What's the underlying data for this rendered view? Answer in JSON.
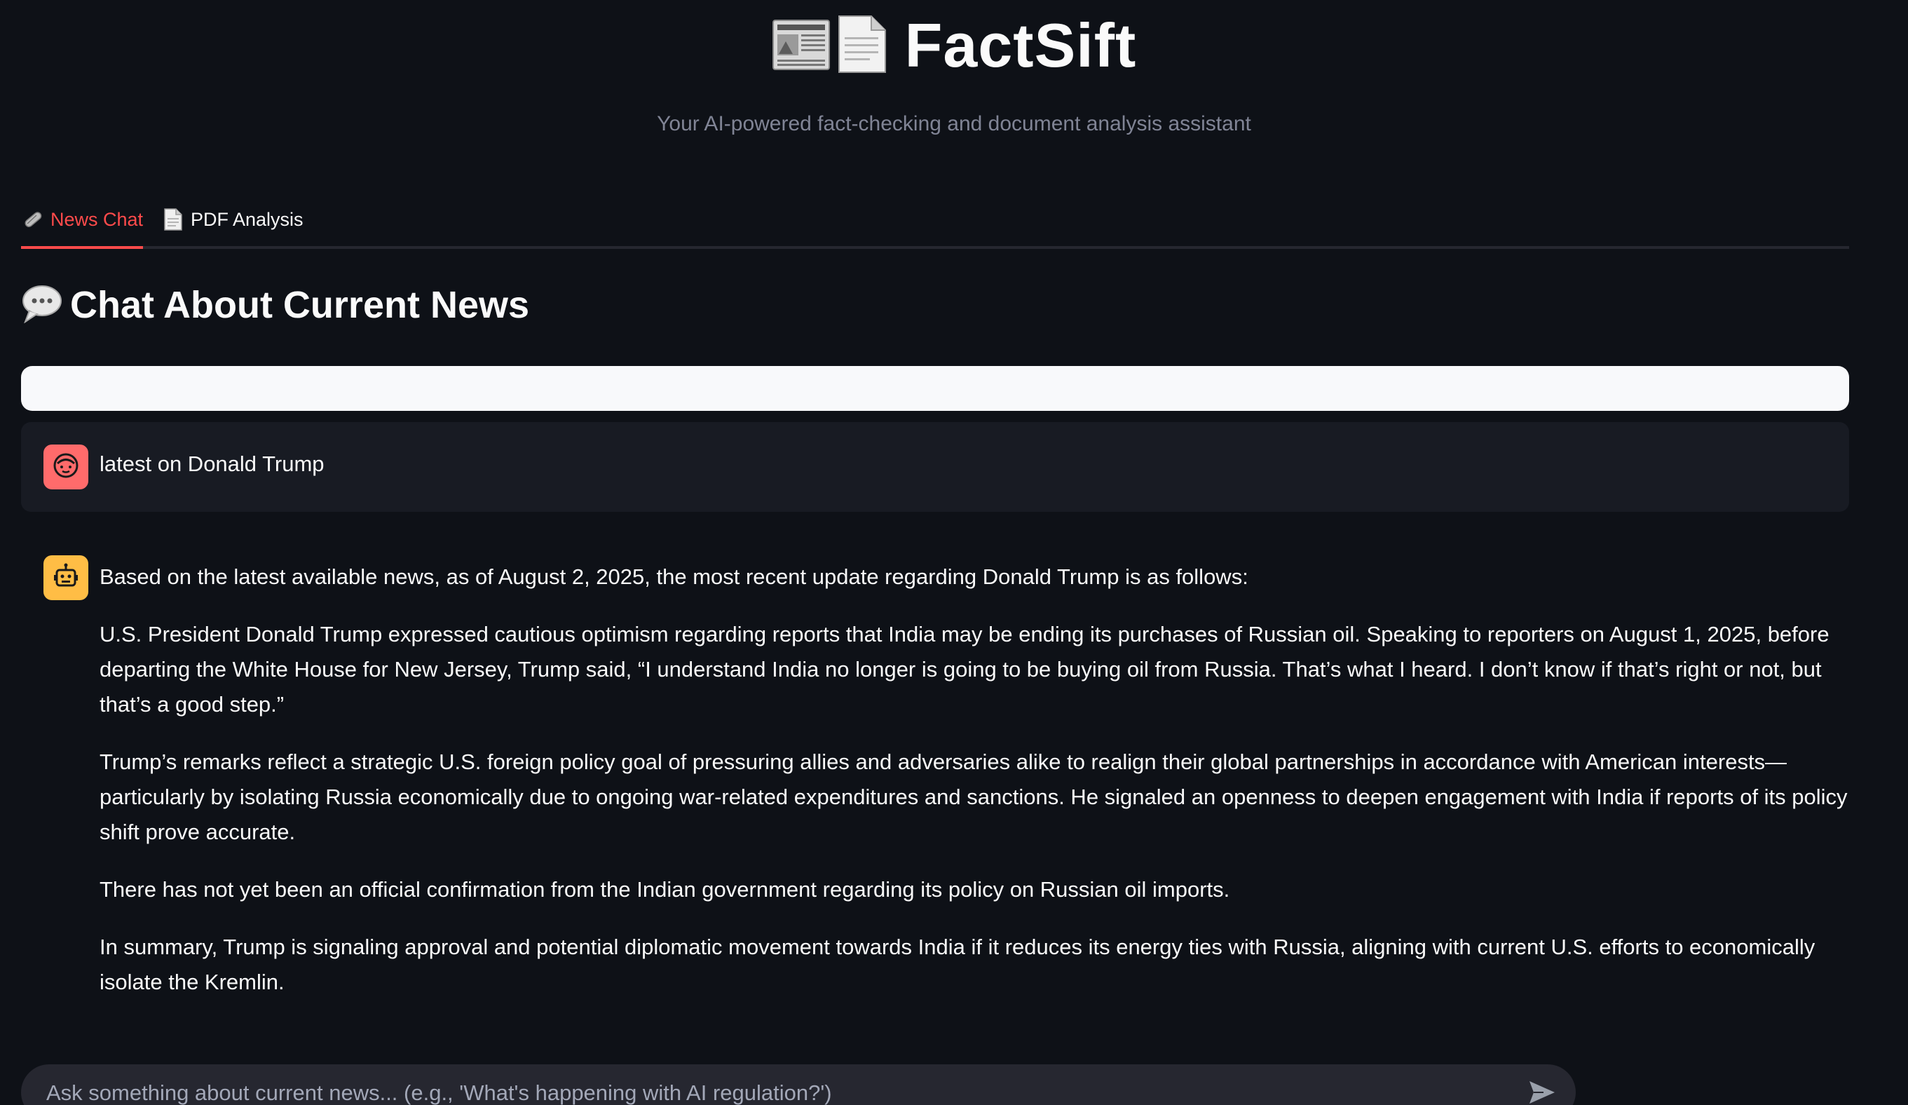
{
  "header": {
    "title": "FactSift",
    "subtitle": "Your AI-powered fact-checking and document analysis assistant",
    "title_icons": [
      "newspaper-icon",
      "document-icon"
    ]
  },
  "tabs": [
    {
      "label": "News Chat",
      "icon": "rolled-newspaper-icon",
      "active": true
    },
    {
      "label": "PDF Analysis",
      "icon": "document-icon",
      "active": false
    }
  ],
  "section": {
    "heading": "Chat About Current News",
    "icon": "speech-bubble-icon"
  },
  "messages": {
    "user": {
      "text": "latest on Donald Trump",
      "avatar_icon": "user-face-icon"
    },
    "assistant": {
      "avatar_icon": "robot-icon",
      "paragraphs": [
        "Based on the latest available news, as of August 2, 2025, the most recent update regarding Donald Trump is as follows:",
        "U.S. President Donald Trump expressed cautious optimism regarding reports that India may be ending its purchases of Russian oil. Speaking to reporters on August 1, 2025, before departing the White House for New Jersey, Trump said, “I understand India no longer is going to be buying oil from Russia. That’s what I heard. I don’t know if that’s right or not, but that’s a good step.”",
        "Trump’s remarks reflect a strategic U.S. foreign policy goal of pressuring allies and adversaries alike to realign their global partnerships in accordance with American interests—particularly by isolating Russia economically due to ongoing war-related expenditures and sanctions. He signaled an openness to deepen engagement with India if reports of its policy shift prove accurate.",
        "There has not yet been an official confirmation from the Indian government regarding its policy on Russian oil imports.",
        "In summary, Trump is signaling approval and potential diplomatic movement towards India if it reduces its energy ties with Russia, aligning with current U.S. efforts to economically isolate the Kremlin."
      ]
    }
  },
  "chat_input": {
    "placeholder": "Ask something about current news... (e.g., 'What's happening with AI regulation?')",
    "value": "",
    "send_icon": "send-icon"
  },
  "colors": {
    "background": "#0e1117",
    "accent": "#ff4b4b",
    "user_avatar": "#ff6b6b",
    "bot_avatar": "#ffbd45",
    "muted_text": "#808495"
  }
}
